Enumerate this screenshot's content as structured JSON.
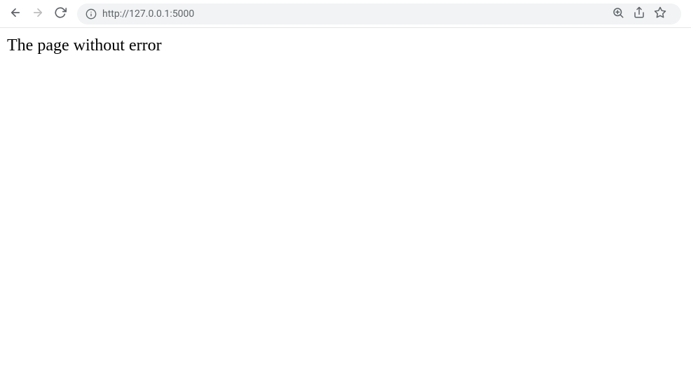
{
  "toolbar": {
    "url": "http://127.0.0.1:5000"
  },
  "page": {
    "heading": "The page without error"
  }
}
